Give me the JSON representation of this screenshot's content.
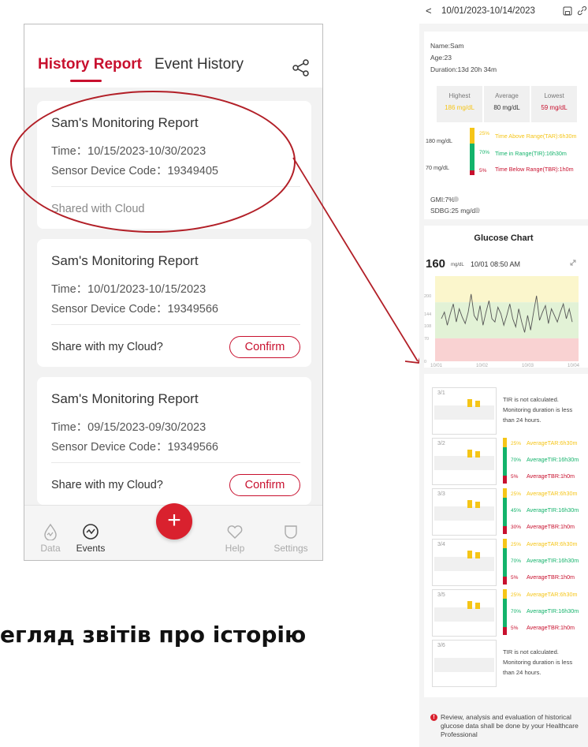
{
  "left_app": {
    "tabs": {
      "history": "History Report",
      "events": "Event History"
    },
    "reports": [
      {
        "title": "Sam's Monitoring Report",
        "time": "Time：10/15/2023-10/30/2023",
        "sensor": "Sensor Device Code：19349405",
        "footer": "Shared with Cloud",
        "button": ""
      },
      {
        "title": "Sam's Monitoring Report",
        "time": "Time：10/01/2023-10/15/2023",
        "sensor": "Sensor Device Code：19349566",
        "footer": "Share with my Cloud?",
        "button": "Confirm"
      },
      {
        "title": "Sam's Monitoring Report",
        "time": "Time：09/15/2023-09/30/2023",
        "sensor": "Sensor Device Code：19349566",
        "footer": "Share with my Cloud?",
        "button": "Confirm"
      }
    ],
    "nav": {
      "data": "Data",
      "events": "Events",
      "add": "+",
      "help": "Help",
      "settings": "Settings"
    },
    "accent_color": "#c8102e"
  },
  "caption": "егляд звітів про історію",
  "report": {
    "header": {
      "back": "<",
      "range": "10/01/2023-10/14/2023"
    },
    "name": "Name:Sam",
    "age": "Age:23",
    "duration": "Duration:13d 20h 34m",
    "stats": {
      "highest_label": "Highest",
      "highest_value": "186 mg/dL",
      "average_label": "Average",
      "average_value": "80 mg/dL",
      "lowest_label": "Lowest",
      "lowest_value": "59 mg/dL"
    },
    "ranges": {
      "upper_threshold": "180 mg/dL",
      "lower_threshold": "70 mg/dL",
      "tar": "Time Above Range(TAR):6h30m",
      "tar_pct": "25%",
      "tir": "Time in Range(TIR):16h30m",
      "tir_pct": "70%",
      "tbr": "Time Below Range(TBR):1h0m",
      "tbr_pct": "5%"
    },
    "gmi": "GMI:7%",
    "sdbg": "SDBG:25 mg/dL",
    "chart_title": "Glucose Chart",
    "current": {
      "value": "160",
      "unit": "mg/dL",
      "time": "10/01 08:50 AM"
    },
    "daily": [
      {
        "day": "3/1",
        "calculated": false,
        "text": [
          "TIR is not calculated.",
          "Monitoring duration is less",
          "than 24 hours."
        ]
      },
      {
        "day": "3/2",
        "calculated": true,
        "tar_pct": "25%",
        "tir_pct": "70%",
        "tbr_pct": "5%",
        "tar": "AverageTAR:6h30m",
        "tir": "AverageTIR:16h30m",
        "tbr": "AverageTBR:1h0m"
      },
      {
        "day": "3/3",
        "calculated": true,
        "tar_pct": "25%",
        "tir_pct": "45%",
        "tbr_pct": "30%",
        "tar": "AverageTAR:6h30m",
        "tir": "AverageTIR:16h30m",
        "tbr": "AverageTBR:1h0m"
      },
      {
        "day": "3/4",
        "calculated": true,
        "tar_pct": "25%",
        "tir_pct": "70%",
        "tbr_pct": "5%",
        "tar": "AverageTAR:6h30m",
        "tir": "AverageTIR:16h30m",
        "tbr": "AverageTBR:1h0m"
      },
      {
        "day": "3/5",
        "calculated": true,
        "tar_pct": "25%",
        "tir_pct": "70%",
        "tbr_pct": "5%",
        "tar": "AverageTAR:6h30m",
        "tir": "AverageTIR:16h30m",
        "tbr": "AverageTBR:1h0m"
      },
      {
        "day": "3/6",
        "calculated": false,
        "text": [
          "TIR is not calculated.",
          "Monitoring duration is less",
          "than 24 hours."
        ]
      }
    ],
    "footnote": "Review, analysis and evaluation of historical glucose data shall be done by your Healthcare Professional",
    "colors": {
      "above": "#f5c518",
      "in_range": "#13b36b",
      "below": "#c8102e"
    }
  },
  "chart_data": {
    "type": "line",
    "title": "Glucose Chart",
    "x": [
      "10/01",
      "10/02",
      "10/03",
      "10/04"
    ],
    "y_ticks": [
      0,
      70,
      108,
      144,
      200
    ],
    "ylim": [
      0,
      260
    ],
    "bands": {
      "above": [
        180,
        260
      ],
      "in_range": [
        70,
        180
      ],
      "below": [
        0,
        70
      ]
    },
    "series": [
      {
        "values": [
          130,
          150,
          110,
          145,
          175,
          120,
          160,
          135,
          115,
          150,
          205,
          140,
          125,
          170,
          110,
          150,
          185,
          130,
          120,
          165,
          145,
          110,
          140,
          175,
          130,
          105,
          160,
          120,
          88,
          140,
          95,
          150,
          200,
          125,
          150,
          170,
          115,
          160,
          140,
          120,
          150,
          175,
          130,
          160,
          120
        ]
      }
    ]
  }
}
